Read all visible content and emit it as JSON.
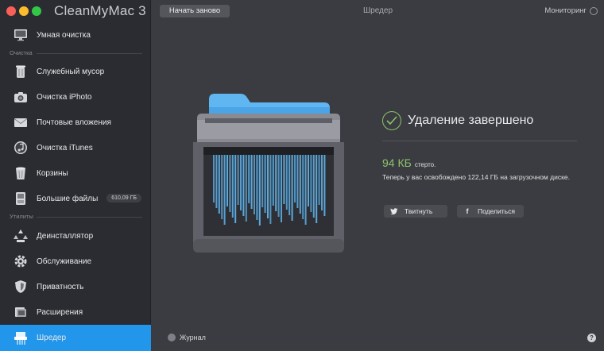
{
  "app": {
    "title": "CleanMyMac 3"
  },
  "sidebar": {
    "top_item": {
      "label": "Умная очистка",
      "icon": "monitor-icon"
    },
    "section_cleanup": "Очистка",
    "cleanup_items": [
      {
        "label": "Служебный мусор",
        "icon": "trash-bin-icon"
      },
      {
        "label": "Очистка iPhoto",
        "icon": "camera-icon"
      },
      {
        "label": "Почтовые вложения",
        "icon": "envelope-icon"
      },
      {
        "label": "Очистка iTunes",
        "icon": "music-note-icon"
      },
      {
        "label": "Корзины",
        "icon": "trash-icon"
      },
      {
        "label": "Большие файлы",
        "icon": "hard-drive-icon",
        "badge": "610,09 ГБ"
      }
    ],
    "section_utilities": "Утилиты",
    "utility_items": [
      {
        "label": "Деинсталлятор",
        "icon": "uninstaller-icon"
      },
      {
        "label": "Обслуживание",
        "icon": "gear-icon"
      },
      {
        "label": "Приватность",
        "icon": "shield-icon"
      },
      {
        "label": "Расширения",
        "icon": "extensions-icon"
      },
      {
        "label": "Шредер",
        "icon": "shredder-icon",
        "active": true
      }
    ]
  },
  "toolbar": {
    "restart_label": "Начать заново",
    "title": "Шредер",
    "monitoring_label": "Мониторинг"
  },
  "result": {
    "title": "Удаление завершено",
    "size": "94 КБ",
    "erased_label": "стерто.",
    "description": "Теперь у вас освобождено 122,14 ГБ на загрузочном диске.",
    "tweet_label": "Твитнуть",
    "share_label": "Поделиться"
  },
  "footer": {
    "journal_label": "Журнал",
    "help_label": "?"
  },
  "colors": {
    "accent": "#2196ea",
    "success": "#8dc26a",
    "folder": "#5fb6f0"
  }
}
